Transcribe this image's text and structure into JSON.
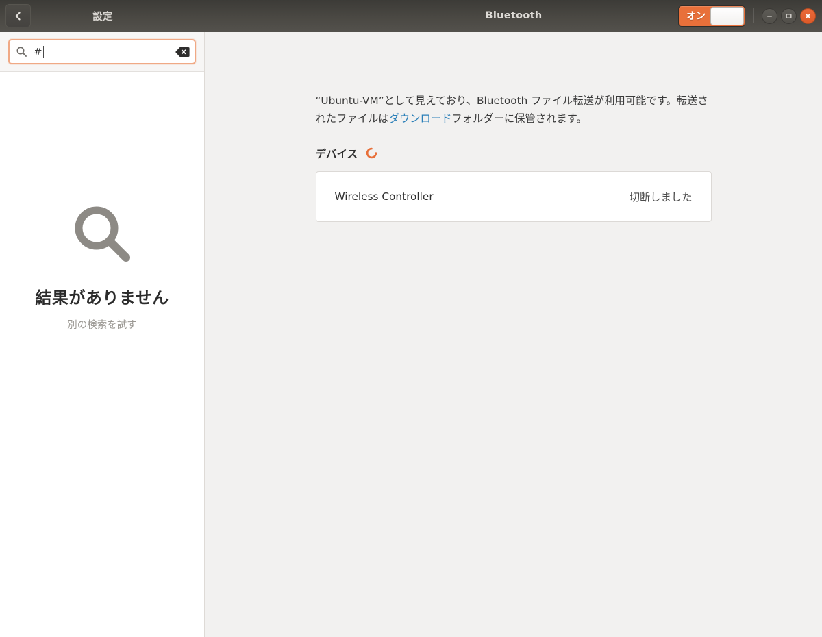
{
  "titlebar": {
    "back_icon": "chevron-left-icon",
    "sidebar_title": "設定",
    "page_title": "Bluetooth",
    "toggle": {
      "label": "オン",
      "state": "on",
      "accent_color": "#e8703a"
    },
    "window_controls": {
      "minimize": "−",
      "maximize": "□",
      "close": "✕",
      "close_color": "#e8703a"
    }
  },
  "sidebar": {
    "search": {
      "value": "#",
      "placeholder": "",
      "search_icon": "search-icon",
      "clear_icon": "clear-icon"
    },
    "empty_state": {
      "icon": "magnifier-icon",
      "title": "結果がありません",
      "subtitle": "別の検索を試す"
    }
  },
  "content": {
    "description": {
      "part1": "“Ubuntu-VM”として見えており、Bluetooth ファイル転送が利用可能です。転送されたファイルは",
      "link": "ダウンロード",
      "part2": "フォルダーに保管されます。"
    },
    "devices_section": {
      "label": "デバイス",
      "spinner": "loading-spinner",
      "spinner_color": "#e8703a",
      "devices": [
        {
          "name": "Wireless Controller",
          "status": "切断しました"
        }
      ]
    }
  }
}
